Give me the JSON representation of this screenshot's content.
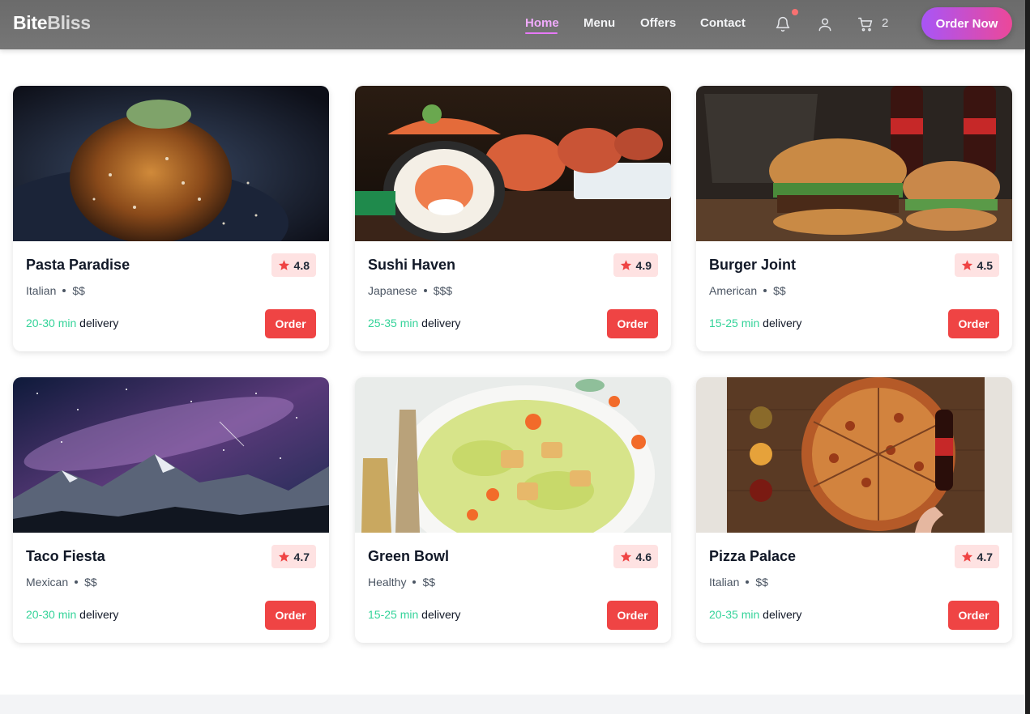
{
  "brand": {
    "part1": "Bite",
    "part2": "Bliss"
  },
  "nav": {
    "items": [
      {
        "label": "Home",
        "active": true
      },
      {
        "label": "Menu",
        "active": false
      },
      {
        "label": "Offers",
        "active": false
      },
      {
        "label": "Contact",
        "active": false
      }
    ],
    "icons": [
      "bell-icon",
      "user-icon",
      "cart-icon"
    ],
    "cart_count": "2",
    "cta_label": "Order Now"
  },
  "restaurants": [
    {
      "name": "Pasta Paradise",
      "rating": "4.8",
      "cuisine": "Italian",
      "price": "$$",
      "time": "20-30 min",
      "delivery_word": "delivery",
      "order_label": "Order"
    },
    {
      "name": "Sushi Haven",
      "rating": "4.9",
      "cuisine": "Japanese",
      "price": "$$$",
      "time": "25-35 min",
      "delivery_word": "delivery",
      "order_label": "Order"
    },
    {
      "name": "Burger Joint",
      "rating": "4.5",
      "cuisine": "American",
      "price": "$$",
      "time": "15-25 min",
      "delivery_word": "delivery",
      "order_label": "Order"
    },
    {
      "name": "Taco Fiesta",
      "rating": "4.7",
      "cuisine": "Mexican",
      "price": "$$",
      "time": "20-30 min",
      "delivery_word": "delivery",
      "order_label": "Order"
    },
    {
      "name": "Green Bowl",
      "rating": "4.6",
      "cuisine": "Healthy",
      "price": "$$",
      "time": "15-25 min",
      "delivery_word": "delivery",
      "order_label": "Order"
    },
    {
      "name": "Pizza Palace",
      "rating": "4.7",
      "cuisine": "Italian",
      "price": "$$",
      "time": "20-35 min",
      "delivery_word": "delivery",
      "order_label": "Order"
    }
  ],
  "colors": {
    "accent_gradient_start": "#a855f7",
    "accent_gradient_end": "#ec4899",
    "order_button": "#ef4444",
    "delivery_time": "#34d399",
    "rating_bg": "#fee2e2",
    "star": "#ef4444"
  }
}
